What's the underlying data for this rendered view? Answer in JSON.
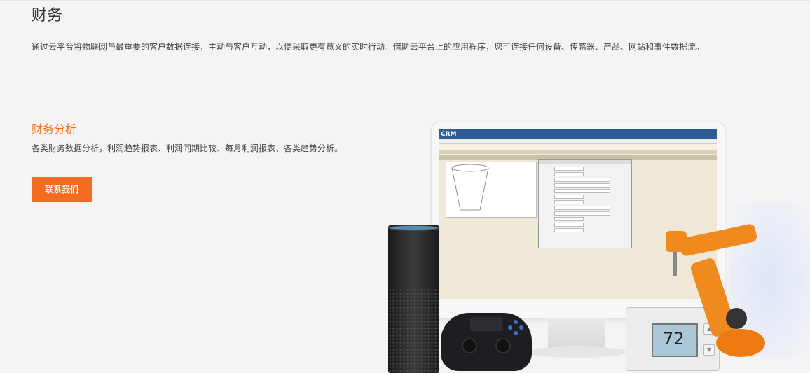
{
  "header": {
    "title": "财务",
    "description": "通过云平台将物联网与最重要的客户数据连接，主动与客户互动，以便采取更有意义的实时行动。借助云平台上的应用程序，您可连接任何设备、传感器、产品、网站和事件数据流。"
  },
  "section": {
    "title": "财务分析",
    "description": "各类财务数据分析，利润趋势报表、利润同期比较、每月利润报表、各类趋势分析。",
    "button_label": "联系我们"
  },
  "illustration": {
    "crm_logo": "CRM",
    "thermostat_temp": "72",
    "colors": {
      "accent": "#f36c21",
      "title_accent": "#ff6a13",
      "crm_header": "#2e5c95"
    }
  }
}
